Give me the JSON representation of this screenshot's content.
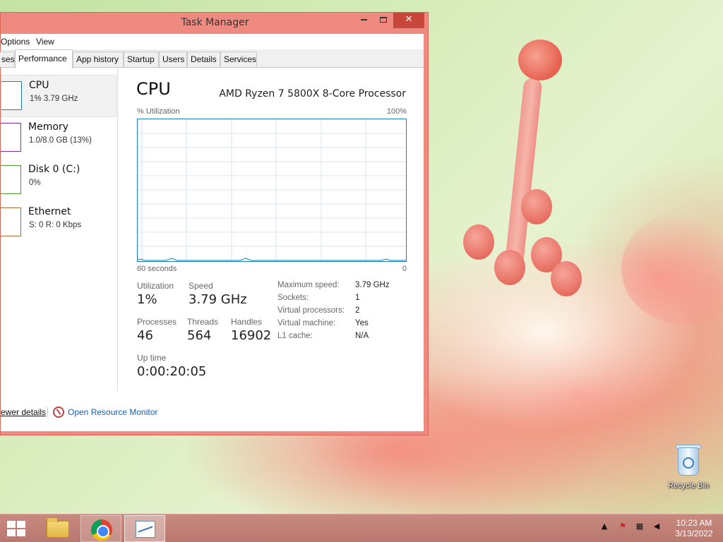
{
  "window": {
    "title": "Task Manager",
    "minimize_glyph": "",
    "maximize_glyph": "",
    "close_glyph": "✕"
  },
  "menu": [
    "Options",
    "View"
  ],
  "tabs": [
    {
      "label": "ses",
      "active": false
    },
    {
      "label": "Performance",
      "active": true
    },
    {
      "label": "App history",
      "active": false
    },
    {
      "label": "Startup",
      "active": false
    },
    {
      "label": "Users",
      "active": false
    },
    {
      "label": "Details",
      "active": false
    },
    {
      "label": "Services",
      "active": false
    }
  ],
  "sidebar": {
    "items": [
      {
        "name": "CPU",
        "sub": "1% 3.79 GHz",
        "color": "#1a7fb9",
        "selected": true
      },
      {
        "name": "Memory",
        "sub": "1.0/8.0 GB (13%)",
        "color": "#8b2a9b",
        "selected": false
      },
      {
        "name": "Disk 0 (C:)",
        "sub": "0%",
        "color": "#4b9a2c",
        "selected": false
      },
      {
        "name": "Ethernet",
        "sub": "S: 0 R: 0 Kbps",
        "color": "#a86a2a",
        "selected": false
      }
    ]
  },
  "main": {
    "title": "CPU",
    "processor": "AMD Ryzen 7 5800X 8-Core Processor",
    "graph": {
      "ylabel": "% Utilization",
      "ymax_label": "100%",
      "xlabel_left": "60 seconds",
      "xlabel_right": "0",
      "line_color": "#1a7fb9",
      "grid_color": "#d9e6ef"
    },
    "stats": {
      "utilization_label": "Utilization",
      "utilization_value": "1%",
      "speed_label": "Speed",
      "speed_value": "3.79 GHz",
      "processes_label": "Processes",
      "processes_value": "46",
      "threads_label": "Threads",
      "threads_value": "564",
      "handles_label": "Handles",
      "handles_value": "16902",
      "uptime_label": "Up time",
      "uptime_value": "0:00:20:05"
    },
    "details": [
      {
        "key": "Maximum speed:",
        "value": "3.79 GHz"
      },
      {
        "key": "Sockets:",
        "value": "1"
      },
      {
        "key": "Virtual processors:",
        "value": "2"
      },
      {
        "key": "Virtual machine:",
        "value": "Yes"
      },
      {
        "key": "L1 cache:",
        "value": "N/A"
      }
    ]
  },
  "footer": {
    "fewer_details": "ewer details",
    "resource_monitor": "Open Resource Monitor"
  },
  "desktop": {
    "recycle_bin_label": "Recycle Bin"
  },
  "taskbar": {
    "apps": [
      "File Explorer",
      "Google Chrome",
      "Task Manager"
    ],
    "clock_time": "10:23 AM",
    "clock_date": "3/13/2022",
    "tray_icons": [
      "show-hidden-icons",
      "action-center-flag-icon",
      "network-icon",
      "volume-muted-icon"
    ]
  },
  "colors": {
    "window_frame": "#ef8a80",
    "close_button": "#c7473b",
    "link": "#1a5fb4"
  }
}
